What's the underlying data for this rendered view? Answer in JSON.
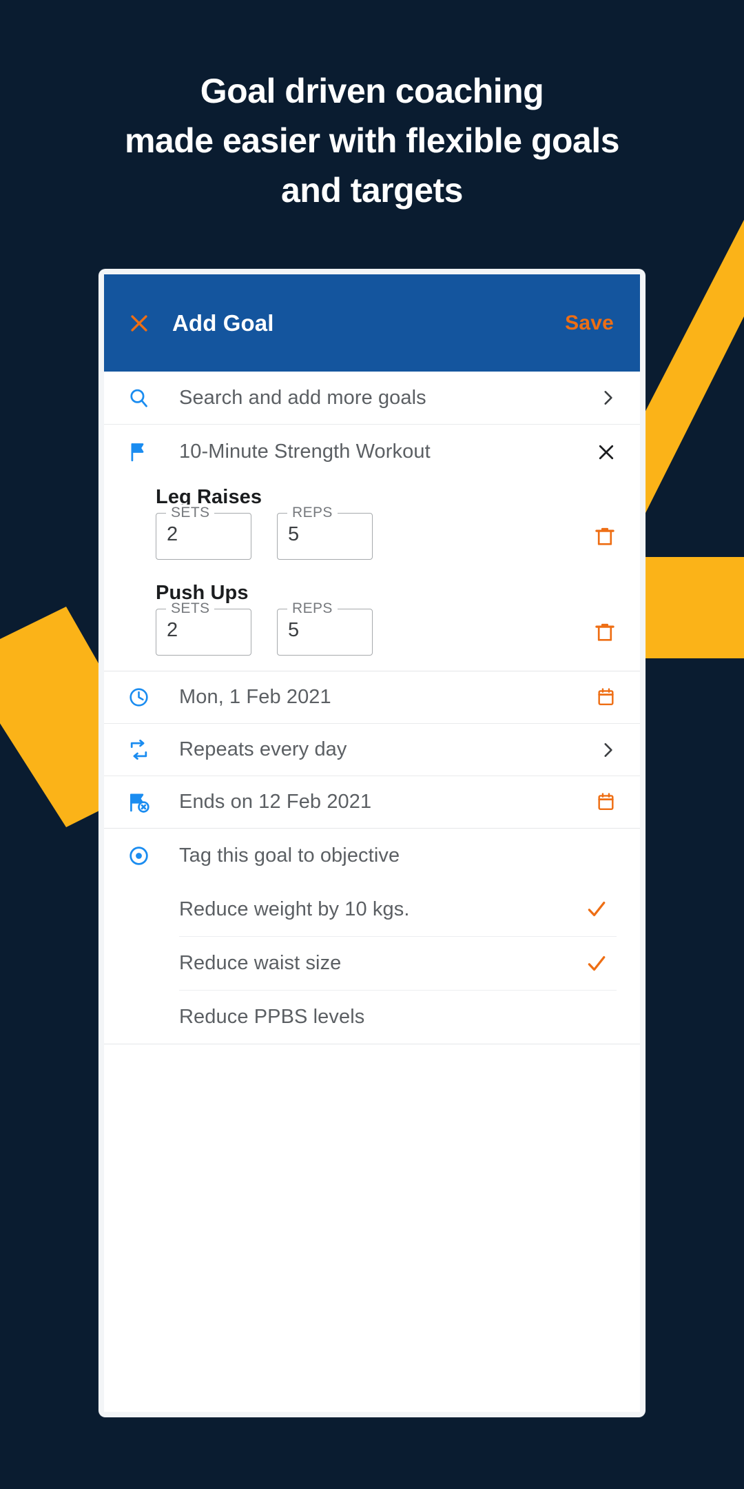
{
  "colors": {
    "background": "#0a1c30",
    "accent_blue": "#14559e",
    "accent_orange": "#ee6e14",
    "icon_blue": "#1a8cf0",
    "decor_yellow": "#fbb318",
    "card_white": "#ffffff"
  },
  "headline": {
    "line1": "Goal driven coaching",
    "line2": "made easier with flexible goals",
    "line3": "and targets"
  },
  "appbar": {
    "close_icon": "close-icon",
    "title": "Add Goal",
    "save_label": "Save"
  },
  "search_row": {
    "icon": "search-icon",
    "label": "Search and add more goals",
    "trailing_icon": "chevron-right-icon"
  },
  "goal_row": {
    "icon": "flag-icon",
    "label": "10-Minute Strength Workout",
    "trailing_icon": "close-icon"
  },
  "exercises": [
    {
      "name": "Leg Raises",
      "fields": [
        {
          "legend": "SETS",
          "value": "2"
        },
        {
          "legend": "REPS",
          "value": "5"
        }
      ],
      "trailing_icon": "trash-icon"
    },
    {
      "name": "Push Ups",
      "fields": [
        {
          "legend": "SETS",
          "value": "2"
        },
        {
          "legend": "REPS",
          "value": "5"
        }
      ],
      "trailing_icon": "trash-icon"
    }
  ],
  "schedule": [
    {
      "icon": "clock-icon",
      "label": "Mon, 1 Feb 2021",
      "trailing_icon": "calendar-icon"
    },
    {
      "icon": "repeat-icon",
      "label": "Repeats every day",
      "trailing_icon": "chevron-right-icon"
    },
    {
      "icon": "flag-end-icon",
      "label": "Ends on 12 Feb 2021",
      "trailing_icon": "calendar-icon"
    }
  ],
  "objective": {
    "icon": "target-icon",
    "heading": "Tag this goal to objective",
    "items": [
      {
        "label": "Reduce weight by 10 kgs.",
        "checked": true
      },
      {
        "label": "Reduce waist size",
        "checked": true
      },
      {
        "label": "Reduce PPBS levels",
        "checked": false
      }
    ]
  }
}
